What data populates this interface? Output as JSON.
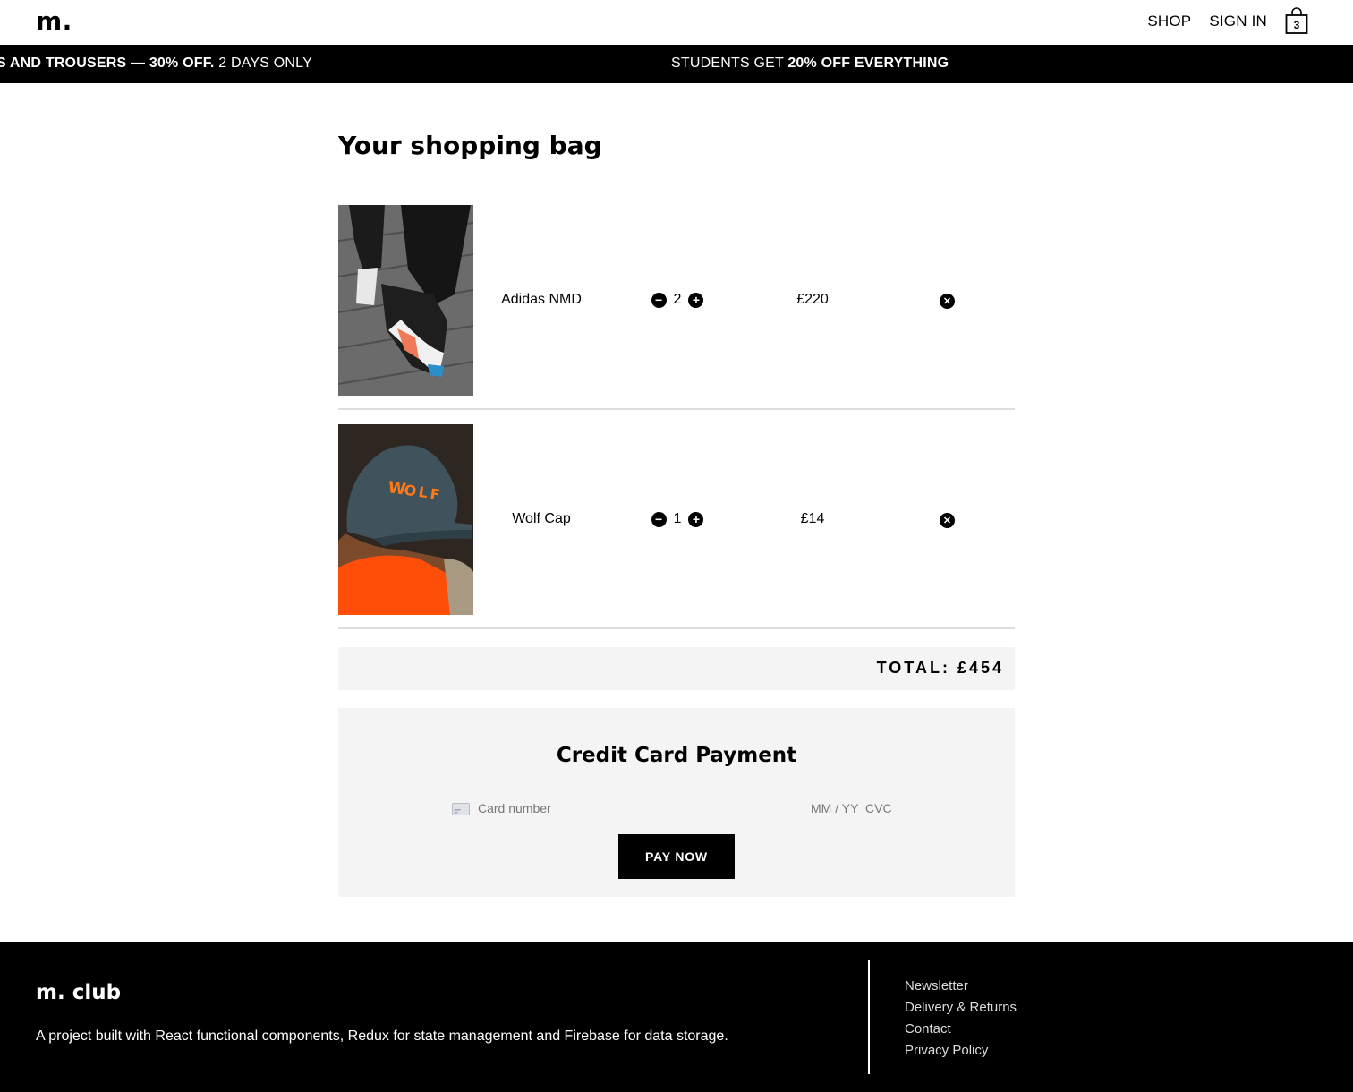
{
  "header": {
    "logo": "m.",
    "nav": {
      "shop": "SHOP",
      "sign_in": "SIGN IN"
    },
    "bag_count": "3"
  },
  "banner": {
    "promo_1": {
      "prefix": "S AND TROUSERS — 30% OFF.",
      "suffix": " 2 DAYS ONLY"
    },
    "promo_2": {
      "prefix": "STUDENTS GET ",
      "bold": "20% OFF EVERYTHING"
    }
  },
  "page_title": "Your shopping bag",
  "items": [
    {
      "name": "Adidas NMD",
      "quantity": "2",
      "price": "£220",
      "image": "sneaker-photo"
    },
    {
      "name": "Wolf Cap",
      "quantity": "1",
      "price": "£14",
      "image": "cap-photo"
    }
  ],
  "total": {
    "label": "TOTAL:",
    "value": "£454"
  },
  "payment": {
    "title": "Credit Card Payment",
    "card_number_placeholder": "Card number",
    "expiry_placeholder": "MM / YY",
    "cvc_placeholder": "CVC",
    "pay_button": "PAY NOW"
  },
  "footer": {
    "title": "m. club",
    "description": "A project built with React functional components, Redux for state management and Firebase for data storage.",
    "links": [
      "Newsletter",
      "Delivery & Returns",
      "Contact",
      "Privacy Policy"
    ]
  },
  "colors": {
    "primary": "#000000",
    "panel": "#f4f4f4",
    "divider": "#dddddd",
    "placeholder": "#777777"
  }
}
